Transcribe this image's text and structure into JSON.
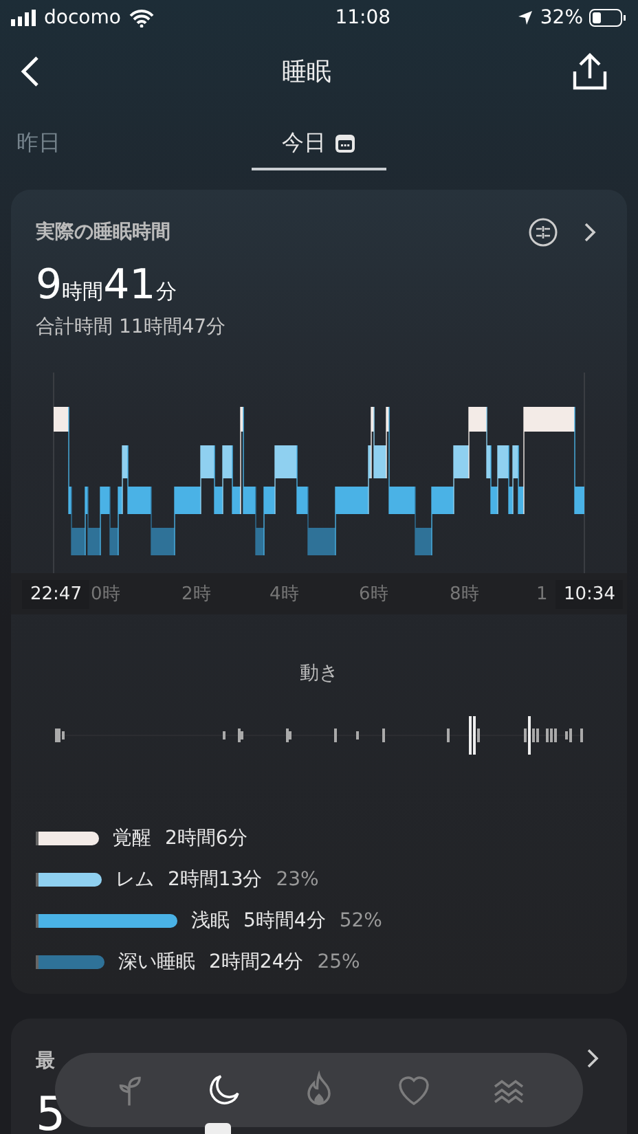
{
  "status_bar": {
    "carrier": "docomo",
    "time": "11:08",
    "battery": "32%"
  },
  "header": {
    "title": "睡眠"
  },
  "day_tabs": [
    {
      "label": "昨日",
      "selected": false
    },
    {
      "label": "今日",
      "selected": true
    }
  ],
  "sleep_card": {
    "title": "実際の睡眠時間",
    "hours": "9",
    "hours_unit": "時間",
    "minutes": "41",
    "minutes_unit": "分",
    "total": "合計時間 11時間47分",
    "start_time": "22:47",
    "end_time": "10:34",
    "axis_labels": [
      "0時",
      "2時",
      "4時",
      "6時",
      "8時",
      "1"
    ],
    "movement_title": "動き",
    "legend": [
      {
        "kind": "awake",
        "label": "覚醒",
        "duration": "2時間6分"
      },
      {
        "kind": "rem",
        "label": "レム",
        "duration": "2時間13分",
        "percent": "23%"
      },
      {
        "kind": "light",
        "label": "浅眠",
        "duration": "5時間4分",
        "percent": "52%"
      },
      {
        "kind": "deep",
        "label": "深い睡眠",
        "duration": "2時間24分",
        "percent": "25%"
      }
    ]
  },
  "heart_card": {
    "title": "最",
    "value": "5"
  },
  "bottom_nav": [
    {
      "kind": "sprout",
      "selected": false
    },
    {
      "kind": "moon",
      "selected": true
    },
    {
      "kind": "flame",
      "selected": false
    },
    {
      "kind": "heart",
      "selected": false
    },
    {
      "kind": "waves",
      "selected": false
    }
  ]
}
